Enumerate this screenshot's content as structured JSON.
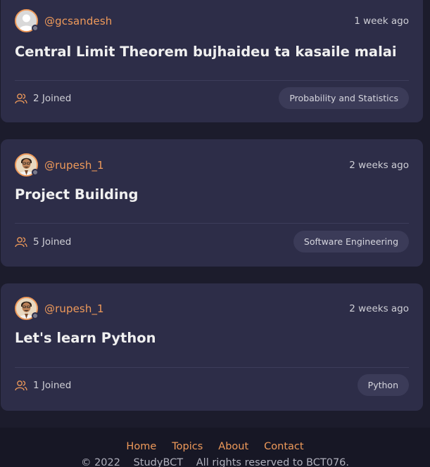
{
  "rooms": [
    {
      "username": "@gcsandesh",
      "avatar": "default-user-avatar",
      "time": "1 week ago",
      "title": "Central Limit Theorem bujhaideu ta kasaile malai",
      "joined": "2 Joined",
      "topic": "Probability and Statistics"
    },
    {
      "username": "@rupesh_1",
      "avatar": "user-photo-avatar",
      "time": "2 weeks ago",
      "title": "Project Building",
      "joined": "5 Joined",
      "topic": "Software Engineering"
    },
    {
      "username": "@rupesh_1",
      "avatar": "user-photo-avatar",
      "time": "2 weeks ago",
      "title": "Let's learn Python",
      "joined": "1 Joined",
      "topic": "Python"
    }
  ],
  "footer": {
    "links": [
      "Home",
      "Topics",
      "About",
      "Contact"
    ],
    "copyright": [
      "© 2022",
      "StudyBCT",
      "All rights reserved to BCT076."
    ]
  },
  "colors": {
    "background": "#1c1c2c",
    "card": "#2d2d48",
    "accent": "#ef9a5a",
    "topic_pill": "#3b3b58",
    "footer": "#171725"
  }
}
